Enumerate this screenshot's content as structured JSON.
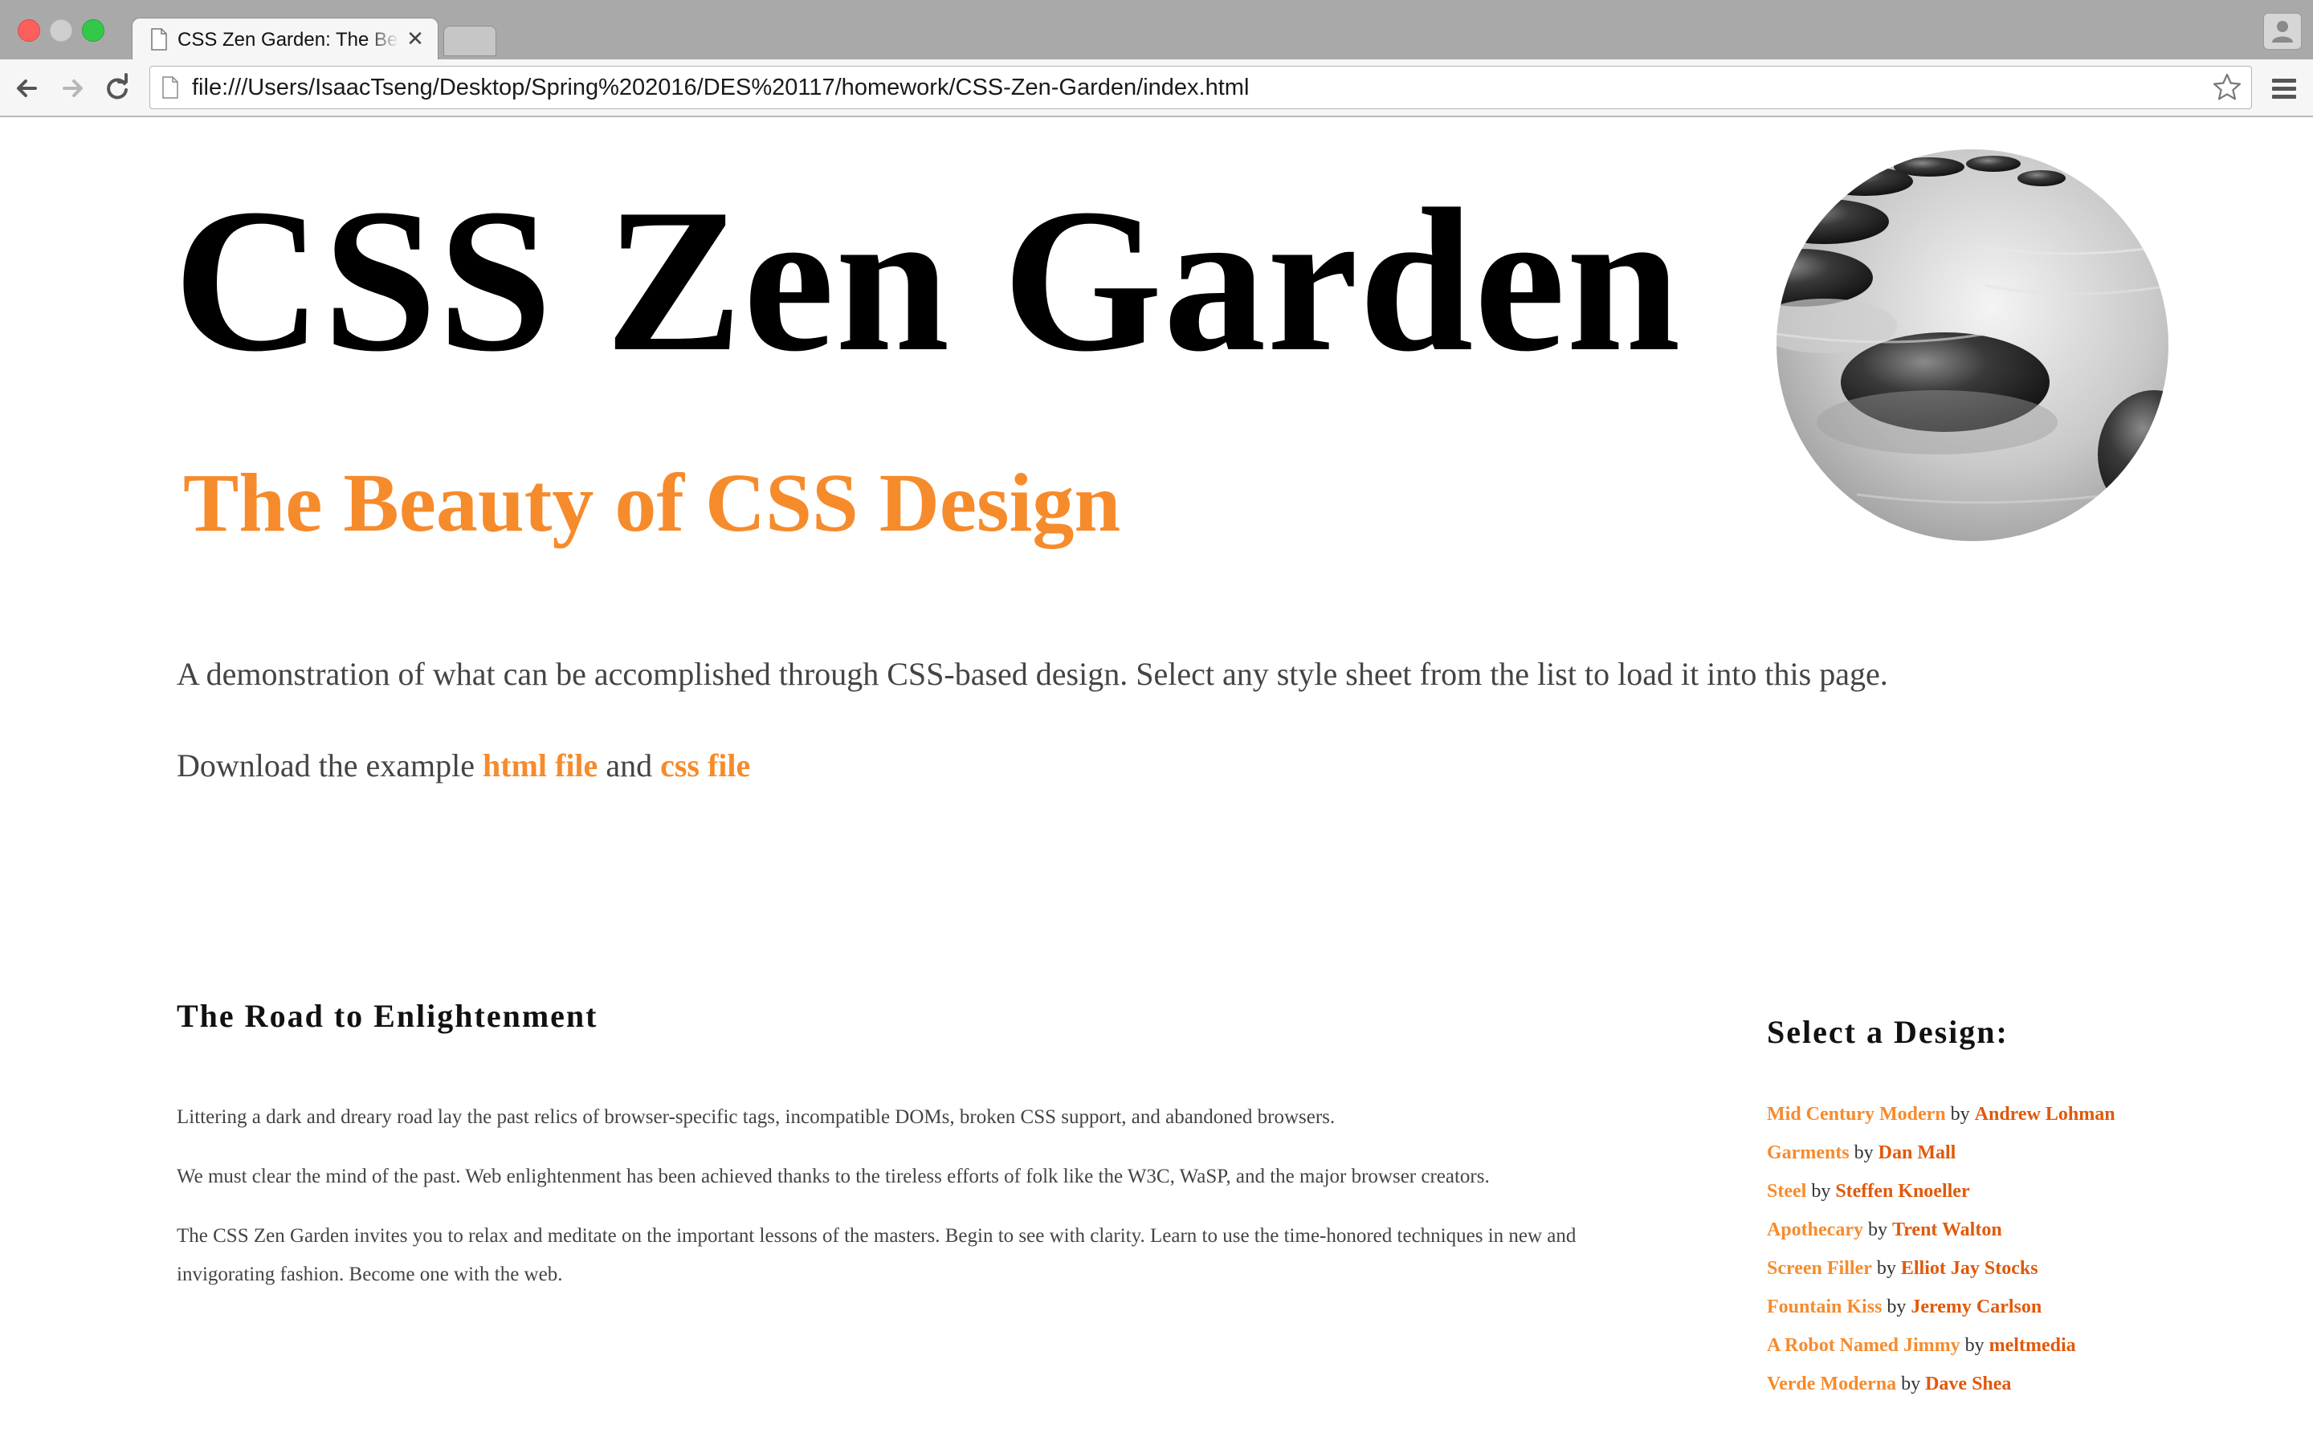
{
  "browser": {
    "tab_title": "CSS Zen Garden: The Beauty of CSS Design",
    "url": "file:///Users/IsaacTseng/Desktop/Spring%202016/DES%20117/homework/CSS-Zen-Garden/index.html",
    "close_glyph": "✕",
    "icons": [
      "back-icon",
      "forward-icon",
      "reload-icon",
      "page-icon",
      "star-icon",
      "menu-icon",
      "profile-icon"
    ]
  },
  "page": {
    "title": "CSS Zen Garden",
    "subtitle": "The Beauty of CSS Design",
    "intro": "A demonstration of what can be accomplished through CSS-based design. Select any style sheet from the list to load it into this page.",
    "download": {
      "prefix": "Download the example ",
      "html_link": "html file",
      "middle": " and ",
      "css_link": "css file"
    },
    "road": {
      "title": "The Road to Enlightenment",
      "paragraphs": [
        "Littering a dark and dreary road lay the past relics of browser-specific tags, incompatible DOMs, broken CSS support, and abandoned browsers.",
        "We must clear the mind of the past. Web enlightenment has been achieved thanks to the tireless efforts of folk like the W3C, WaSP, and the major browser creators.",
        "The CSS Zen Garden invites you to relax and meditate on the important lessons of the masters. Begin to see with clarity. Learn to use the time-honored techniques in new and invigorating fashion. Become one with the web."
      ]
    },
    "select": {
      "title": "Select a Design:",
      "by": " by ",
      "designs": [
        {
          "name": "Mid Century Modern",
          "author": "Andrew Lohman"
        },
        {
          "name": "Garments",
          "author": "Dan Mall"
        },
        {
          "name": "Steel",
          "author": "Steffen Knoeller"
        },
        {
          "name": "Apothecary",
          "author": "Trent Walton"
        },
        {
          "name": "Screen Filler",
          "author": "Elliot Jay Stocks"
        },
        {
          "name": "Fountain Kiss",
          "author": "Jeremy Carlson"
        },
        {
          "name": "A Robot Named Jimmy",
          "author": "meltmedia"
        },
        {
          "name": "Verde Moderna",
          "author": "Dave Shea"
        }
      ]
    }
  },
  "colors": {
    "accent": "#f68b2c",
    "author": "#e0590b",
    "body_text": "#444444",
    "tabbar": "#a9a9a9"
  }
}
